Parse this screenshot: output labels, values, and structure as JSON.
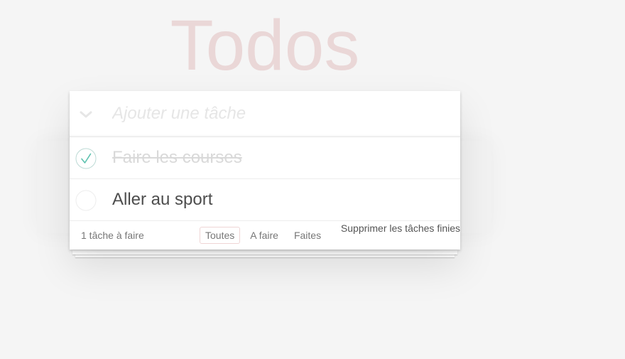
{
  "app": {
    "title": "Todos"
  },
  "header": {
    "toggle_all_icon": "chevron-down-icon",
    "new_todo_placeholder": "Ajouter une tâche",
    "new_todo_value": ""
  },
  "todos": [
    {
      "label": "Faire les courses",
      "completed": true
    },
    {
      "label": "Aller au sport",
      "completed": false
    }
  ],
  "footer": {
    "count_text": "1 tâche à faire",
    "filters": [
      {
        "label": "Toutes",
        "selected": true
      },
      {
        "label": "A faire",
        "selected": false
      },
      {
        "label": "Faites",
        "selected": false
      }
    ],
    "clear_completed_label": "Supprimer les tâches finies"
  },
  "colors": {
    "title": "#eed5d5",
    "check": "#5dc2af",
    "circle": "#ededed",
    "selected_border": "#efd5d5"
  }
}
